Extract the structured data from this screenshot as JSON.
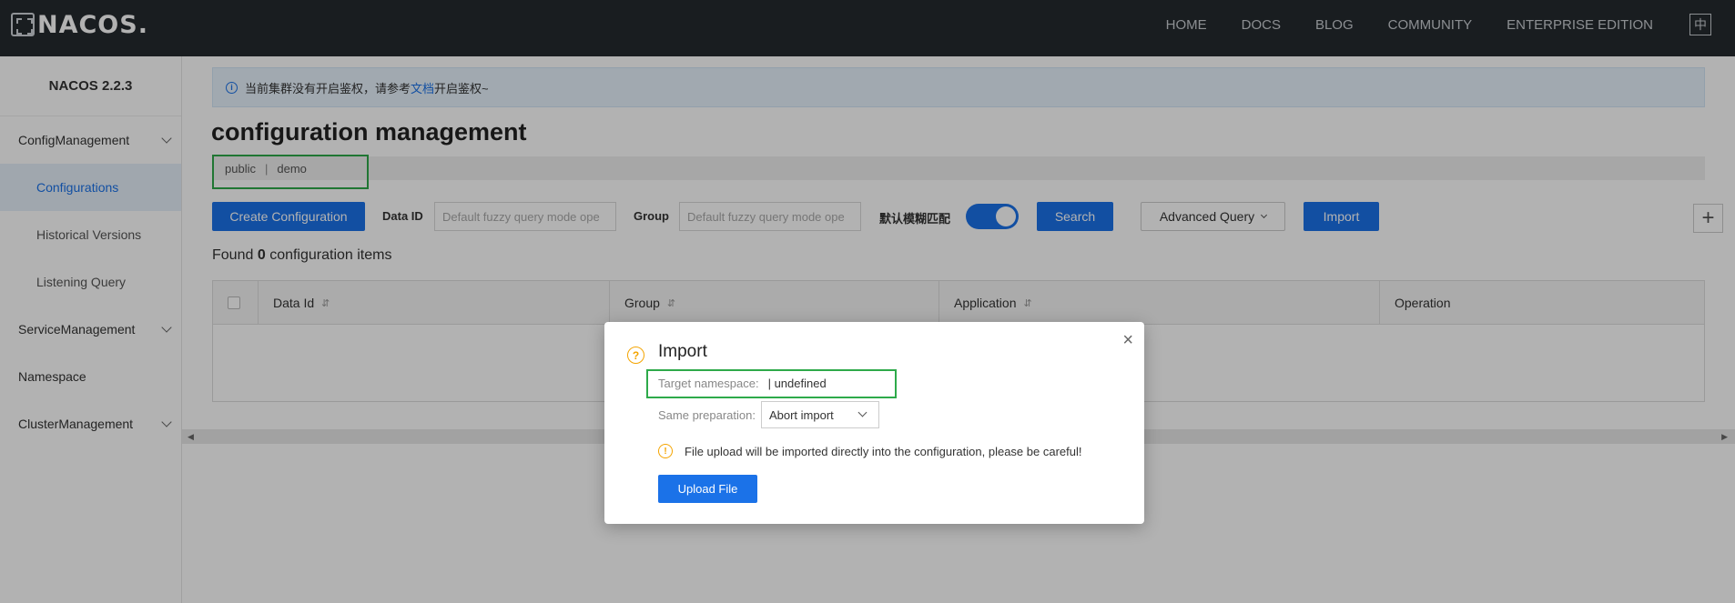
{
  "header": {
    "logo_text": "NACOS.",
    "nav": [
      "HOME",
      "DOCS",
      "BLOG",
      "COMMUNITY",
      "ENTERPRISE EDITION"
    ],
    "lang_button": "中"
  },
  "sidebar": {
    "version": "NACOS 2.2.3",
    "items": [
      {
        "label": "ConfigManagement",
        "expandable": true
      },
      {
        "label": "Configurations",
        "active": true
      },
      {
        "label": "Historical Versions"
      },
      {
        "label": "Listening Query"
      },
      {
        "label": "ServiceManagement",
        "expandable": true
      },
      {
        "label": "Namespace"
      },
      {
        "label": "ClusterManagement",
        "expandable": true
      }
    ]
  },
  "main": {
    "notice": {
      "prefix": "当前集群没有开启鉴权，请参考",
      "link": "文档",
      "suffix": "开启鉴权~"
    },
    "title": "configuration management",
    "namespaces": [
      "public",
      "demo"
    ],
    "namespace_separator": "|",
    "toolbar": {
      "create_button": "Create Configuration",
      "data_id_label": "Data ID",
      "data_id_placeholder": "Default fuzzy query mode ope",
      "group_label": "Group",
      "group_placeholder": "Default fuzzy query mode ope",
      "fuzzy_label": "默认模糊匹配",
      "fuzzy_enabled": true,
      "search_button": "Search",
      "advanced_button": "Advanced Query",
      "import_button": "Import",
      "add_icon": "plus-icon"
    },
    "found": {
      "prefix": "Found",
      "count": "0",
      "suffix": "configuration items"
    },
    "table": {
      "columns": [
        "Data Id",
        "Group",
        "Application",
        "Operation"
      ],
      "rows": []
    }
  },
  "dialog": {
    "title": "Import",
    "target_namespace_label": "Target namespace:",
    "target_namespace_value": "| undefined",
    "same_preparation_label": "Same preparation:",
    "same_preparation_value": "Abort import",
    "warning": "File upload will be imported directly into the configuration, please be careful!",
    "upload_button": "Upload File",
    "close_icon": "close-icon"
  },
  "colors": {
    "primary": "#1b72e8",
    "header_bg": "#252a2f",
    "highlight_box": "#2eaa4a",
    "warning": "#f4a400"
  }
}
